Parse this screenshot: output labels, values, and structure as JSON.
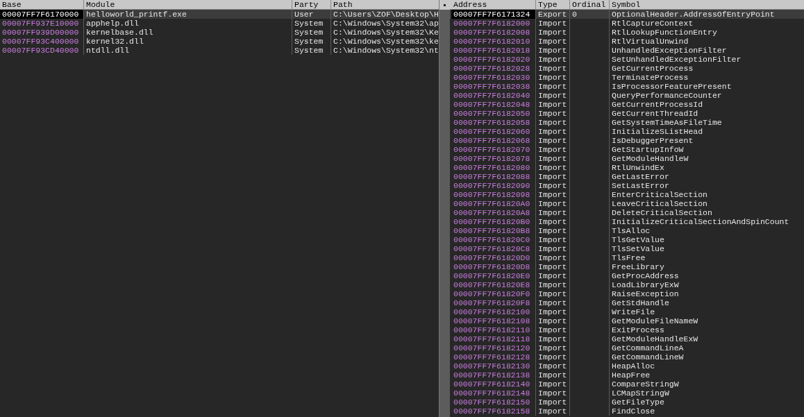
{
  "modules": {
    "columns": [
      "Base",
      "Module",
      "Party",
      "Path"
    ],
    "rows": [
      {
        "base": "00007FF7F6170000",
        "module": "helloworld_printf.exe",
        "party": "User",
        "path": "C:\\Users\\ZOF\\Desktop\\H",
        "selected": true
      },
      {
        "base": "00007FF937E10000",
        "module": "apphelp.dll",
        "party": "System",
        "path": "C:\\Windows\\System32\\ap",
        "selected": false
      },
      {
        "base": "00007FF939D00000",
        "module": "kernelbase.dll",
        "party": "System",
        "path": "C:\\Windows\\System32\\Ke",
        "selected": false
      },
      {
        "base": "00007FF93C400000",
        "module": "kernel32.dll",
        "party": "System",
        "path": "C:\\Windows\\System32\\ke",
        "selected": false
      },
      {
        "base": "00007FF93CD40000",
        "module": "ntdll.dll",
        "party": "System",
        "path": "C:\\Windows\\System32\\nt",
        "selected": false
      }
    ]
  },
  "symbols": {
    "columns": [
      "Address",
      "Type",
      "Ordinal",
      "Symbol"
    ],
    "rows": [
      {
        "address": "00007FF7F6171324",
        "type": "Export",
        "ordinal": "0",
        "symbol": "OptionalHeader.AddressOfEntryPoint",
        "selected": true
      },
      {
        "address": "00007FF7F6182000",
        "type": "Import",
        "symbol": "RtlCaptureContext",
        "selected": false
      },
      {
        "address": "00007FF7F6182008",
        "type": "Import",
        "symbol": "RtlLookupFunctionEntry",
        "selected": false
      },
      {
        "address": "00007FF7F6182010",
        "type": "Import",
        "symbol": "RtlVirtualUnwind",
        "selected": false
      },
      {
        "address": "00007FF7F6182018",
        "type": "Import",
        "symbol": "UnhandledExceptionFilter",
        "selected": false
      },
      {
        "address": "00007FF7F6182020",
        "type": "Import",
        "symbol": "SetUnhandledExceptionFilter",
        "selected": false
      },
      {
        "address": "00007FF7F6182028",
        "type": "Import",
        "symbol": "GetCurrentProcess",
        "selected": false
      },
      {
        "address": "00007FF7F6182030",
        "type": "Import",
        "symbol": "TerminateProcess",
        "selected": false
      },
      {
        "address": "00007FF7F6182038",
        "type": "Import",
        "symbol": "IsProcessorFeaturePresent",
        "selected": false
      },
      {
        "address": "00007FF7F6182040",
        "type": "Import",
        "symbol": "QueryPerformanceCounter",
        "selected": false
      },
      {
        "address": "00007FF7F6182048",
        "type": "Import",
        "symbol": "GetCurrentProcessId",
        "selected": false
      },
      {
        "address": "00007FF7F6182050",
        "type": "Import",
        "symbol": "GetCurrentThreadId",
        "selected": false
      },
      {
        "address": "00007FF7F6182058",
        "type": "Import",
        "symbol": "GetSystemTimeAsFileTime",
        "selected": false
      },
      {
        "address": "00007FF7F6182060",
        "type": "Import",
        "symbol": "InitializeSListHead",
        "selected": false
      },
      {
        "address": "00007FF7F6182068",
        "type": "Import",
        "symbol": "IsDebuggerPresent",
        "selected": false
      },
      {
        "address": "00007FF7F6182070",
        "type": "Import",
        "symbol": "GetStartupInfoW",
        "selected": false
      },
      {
        "address": "00007FF7F6182078",
        "type": "Import",
        "symbol": "GetModuleHandleW",
        "selected": false
      },
      {
        "address": "00007FF7F6182080",
        "type": "Import",
        "symbol": "RtlUnwindEx",
        "selected": false
      },
      {
        "address": "00007FF7F6182088",
        "type": "Import",
        "symbol": "GetLastError",
        "selected": false
      },
      {
        "address": "00007FF7F6182090",
        "type": "Import",
        "symbol": "SetLastError",
        "selected": false
      },
      {
        "address": "00007FF7F6182098",
        "type": "Import",
        "symbol": "EnterCriticalSection",
        "selected": false
      },
      {
        "address": "00007FF7F61820A0",
        "type": "Import",
        "symbol": "LeaveCriticalSection",
        "selected": false
      },
      {
        "address": "00007FF7F61820A8",
        "type": "Import",
        "symbol": "DeleteCriticalSection",
        "selected": false
      },
      {
        "address": "00007FF7F61820B0",
        "type": "Import",
        "symbol": "InitializeCriticalSectionAndSpinCount",
        "selected": false
      },
      {
        "address": "00007FF7F61820B8",
        "type": "Import",
        "symbol": "TlsAlloc",
        "selected": false
      },
      {
        "address": "00007FF7F61820C0",
        "type": "Import",
        "symbol": "TlsGetValue",
        "selected": false
      },
      {
        "address": "00007FF7F61820C8",
        "type": "Import",
        "symbol": "TlsSetValue",
        "selected": false
      },
      {
        "address": "00007FF7F61820D0",
        "type": "Import",
        "symbol": "TlsFree",
        "selected": false
      },
      {
        "address": "00007FF7F61820D8",
        "type": "Import",
        "symbol": "FreeLibrary",
        "selected": false
      },
      {
        "address": "00007FF7F61820E0",
        "type": "Import",
        "symbol": "GetProcAddress",
        "selected": false
      },
      {
        "address": "00007FF7F61820E8",
        "type": "Import",
        "symbol": "LoadLibraryExW",
        "selected": false
      },
      {
        "address": "00007FF7F61820F0",
        "type": "Import",
        "symbol": "RaiseException",
        "selected": false
      },
      {
        "address": "00007FF7F61820F8",
        "type": "Import",
        "symbol": "GetStdHandle",
        "selected": false
      },
      {
        "address": "00007FF7F6182100",
        "type": "Import",
        "symbol": "WriteFile",
        "selected": false
      },
      {
        "address": "00007FF7F6182108",
        "type": "Import",
        "symbol": "GetModuleFileNameW",
        "selected": false
      },
      {
        "address": "00007FF7F6182110",
        "type": "Import",
        "symbol": "ExitProcess",
        "selected": false
      },
      {
        "address": "00007FF7F6182118",
        "type": "Import",
        "symbol": "GetModuleHandleExW",
        "selected": false
      },
      {
        "address": "00007FF7F6182120",
        "type": "Import",
        "symbol": "GetCommandLineA",
        "selected": false
      },
      {
        "address": "00007FF7F6182128",
        "type": "Import",
        "symbol": "GetCommandLineW",
        "selected": false
      },
      {
        "address": "00007FF7F6182130",
        "type": "Import",
        "symbol": "HeapAlloc",
        "selected": false
      },
      {
        "address": "00007FF7F6182138",
        "type": "Import",
        "symbol": "HeapFree",
        "selected": false
      },
      {
        "address": "00007FF7F6182140",
        "type": "Import",
        "symbol": "CompareStringW",
        "selected": false
      },
      {
        "address": "00007FF7F6182148",
        "type": "Import",
        "symbol": "LCMapStringW",
        "selected": false
      },
      {
        "address": "00007FF7F6182150",
        "type": "Import",
        "symbol": "GetFileType",
        "selected": false
      },
      {
        "address": "00007FF7F6182158",
        "type": "Import",
        "symbol": "FindClose",
        "selected": false
      }
    ]
  }
}
